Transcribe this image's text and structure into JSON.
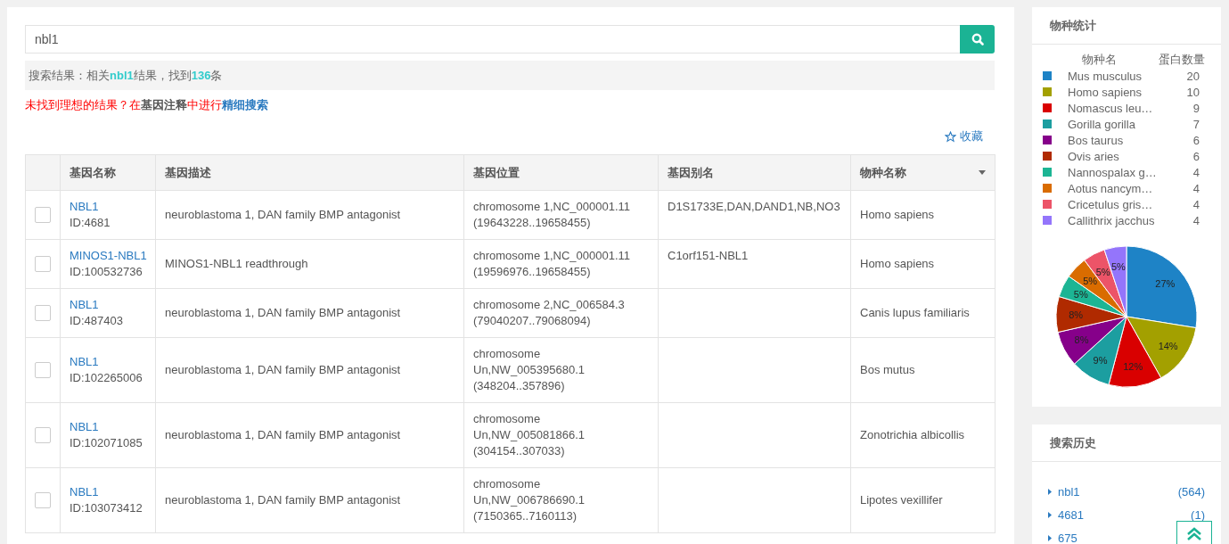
{
  "search": {
    "value": "nbl1"
  },
  "summary": "搜索结果：相关**nbl1**结果，找到**136**条",
  "hint": {
    "text": "未找到理想的结果？在**基因注释**中进行",
    "link": "精细搜索"
  },
  "favorite": "收藏",
  "table": {
    "columns": [
      "基因名称",
      "基因描述",
      "基因位置",
      "基因别名",
      "物种名称"
    ],
    "rows": [
      {
        "selected": false,
        "name": "NBL1",
        "id": "ID:4681",
        "description": "neuroblastoma 1, DAN family BMP antagonist",
        "location": [
          "chromosome 1,NC_000001.11",
          "(19643228..19658455)"
        ],
        "alias": "D1S1733E,DAN,DAND1,NB,NO3",
        "species": "Homo sapiens"
      },
      {
        "selected": false,
        "name": "MINOS1-NBL1",
        "id": "ID:100532736",
        "description": "MINOS1-NBL1 readthrough",
        "location": [
          "chromosome 1,NC_000001.11",
          "(19596976..19658455)"
        ],
        "alias": "C1orf151-NBL1",
        "species": "Homo sapiens"
      },
      {
        "selected": false,
        "name": "NBL1",
        "id": "ID:487403",
        "description": "neuroblastoma 1, DAN family BMP antagonist",
        "location": [
          "chromosome 2,NC_006584.3",
          "(79040207..79068094)"
        ],
        "species": "Canis lupus familiaris"
      },
      {
        "selected": false,
        "name": "NBL1",
        "id": "ID:102265006",
        "description": "neuroblastoma 1, DAN family BMP antagonist",
        "location": [
          "chromosome",
          "Un,NW_005395680.1",
          "(348204..357896)"
        ],
        "species": "Bos mutus"
      },
      {
        "selected": false,
        "name": "NBL1",
        "id": "ID:102071085",
        "description": "neuroblastoma 1, DAN family BMP antagonist",
        "location": [
          "chromosome",
          "Un,NW_005081866.1",
          "(304154..307033)"
        ],
        "species": "Zonotrichia albicollis"
      },
      {
        "selected": false,
        "name": "NBL1",
        "id": "ID:103073412",
        "description": "neuroblastoma 1, DAN family BMP antagonist",
        "location": [
          "chromosome",
          "Un,NW_006786690.1",
          "(7150365..7160113)"
        ],
        "species": "Lipotes vexillifer"
      }
    ]
  },
  "stats": {
    "title": "物种统计",
    "headers": [
      "物种名",
      "蛋白数量"
    ],
    "species": [
      {
        "name": "Mus musculus",
        "count": "20",
        "color": "#1e83c6"
      },
      {
        "name": "Homo sapiens",
        "count": "10",
        "color": "#a3a000"
      },
      {
        "name": "Nomascus leu…",
        "count": "9",
        "color": "#d90000"
      },
      {
        "name": "Gorilla gorilla",
        "count": "7",
        "color": "#1c9ea0"
      },
      {
        "name": "Bos taurus",
        "count": "6",
        "color": "#86008a"
      },
      {
        "name": "Ovis aries",
        "count": "6",
        "color": "#b02a00"
      },
      {
        "name": "Nannospalax g…",
        "count": "4",
        "color": "#1cb594"
      },
      {
        "name": "Aotus nancym…",
        "count": "4",
        "color": "#d96c00"
      },
      {
        "name": "Cricetulus gris…",
        "count": "4",
        "color": "#ec5468"
      },
      {
        "name": "Callithrix jacchus",
        "count": "4",
        "color": "#9475fb"
      }
    ],
    "chart_data": {
      "type": "pie",
      "values": [
        27,
        14,
        12,
        9,
        8,
        8,
        5,
        5,
        5,
        5
      ],
      "data_labels": true,
      "value_labels": [
        "27%",
        "14%",
        "12%",
        "9%",
        "8%",
        "8%",
        "5%",
        "5%",
        "5%",
        "5%"
      ]
    }
  },
  "history": {
    "title": "搜索历史",
    "items": [
      {
        "term": "nbl1",
        "count": "(564)"
      },
      {
        "term": "4681",
        "count": "(1)"
      },
      {
        "term": "675"
      }
    ]
  }
}
